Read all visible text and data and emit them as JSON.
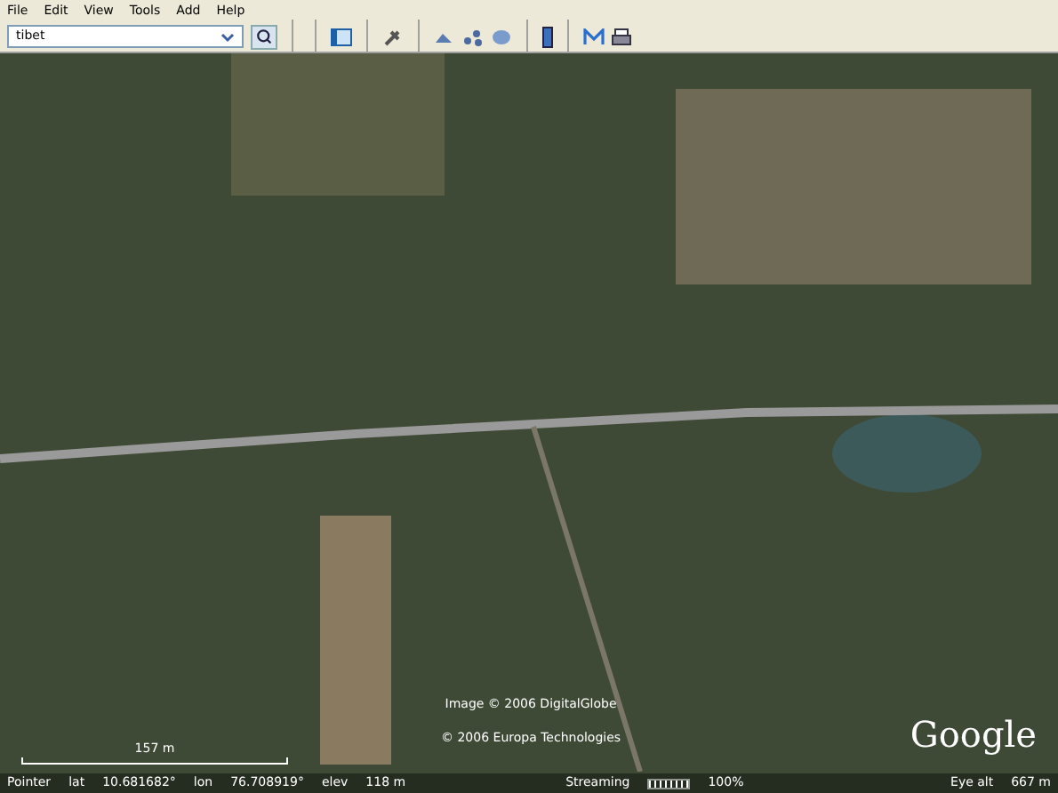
{
  "menu": [
    {
      "label": "File"
    },
    {
      "label": "Edit"
    },
    {
      "label": "View"
    },
    {
      "label": "Tools"
    },
    {
      "label": "Add"
    },
    {
      "label": "Help"
    }
  ],
  "search": {
    "value": "tibet"
  },
  "map": {
    "scale": "157 m",
    "credits": [
      "Image © 2006 DigitalGlobe",
      "© 2006 Europa Technologies"
    ],
    "logo": "Google"
  },
  "status_bar": {
    "pointer": "Pointer",
    "lat_label": "lat",
    "lat": "10.681682°",
    "lon_label": "lon",
    "lon": "76.708919°",
    "elev_label": "elev",
    "elev": "118 m",
    "streaming": "Streaming",
    "level": 1,
    "stream_pct": "100%",
    "eye_label": "Eye alt",
    "eye": "667 m"
  }
}
